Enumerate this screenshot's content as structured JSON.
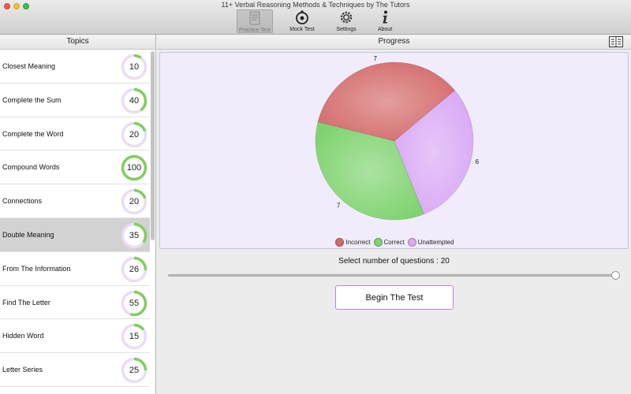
{
  "window": {
    "title": "11+ Verbal Reasoning Methods & Techniques by The Tutors"
  },
  "toolbar": {
    "items": [
      {
        "label": "Practice Test",
        "icon": "practice-test-icon",
        "active": true
      },
      {
        "label": "Mock Test",
        "icon": "stopwatch-icon",
        "active": false
      },
      {
        "label": "Settings",
        "icon": "gear-icon",
        "active": false
      },
      {
        "label": "About",
        "icon": "info-icon",
        "active": false
      }
    ]
  },
  "sidebar": {
    "header": "Topics",
    "selected_index": 5,
    "items": [
      {
        "label": "Closest Meaning",
        "score": 10
      },
      {
        "label": "Complete the Sum",
        "score": 40
      },
      {
        "label": "Complete the Word",
        "score": 20
      },
      {
        "label": "Compound Words",
        "score": 100
      },
      {
        "label": "Connections",
        "score": 20
      },
      {
        "label": "Double Meaning",
        "score": 35
      },
      {
        "label": "From The Information",
        "score": 26
      },
      {
        "label": "Find The Letter",
        "score": 55
      },
      {
        "label": "Hidden Word",
        "score": 15
      },
      {
        "label": "Letter Series",
        "score": 25
      }
    ]
  },
  "main": {
    "header": "Progress",
    "questions_label": "Select number of questions : 20",
    "slider_value": 20,
    "slider_fraction": 1.0,
    "begin_button": "Begin The Test"
  },
  "chart_data": {
    "type": "pie",
    "title": "",
    "slices": [
      {
        "name": "Incorrect",
        "value": 7,
        "color": "#d46a6a"
      },
      {
        "name": "Correct",
        "value": 7,
        "color": "#7fd36f"
      },
      {
        "name": "Unattempted",
        "value": 6,
        "color": "#d9a8f5"
      }
    ],
    "legend_position": "bottom"
  },
  "colors": {
    "ring_fill": "#7fcf5c",
    "ring_track": "#eadcf6",
    "accent_button_border": "#b784d8"
  }
}
